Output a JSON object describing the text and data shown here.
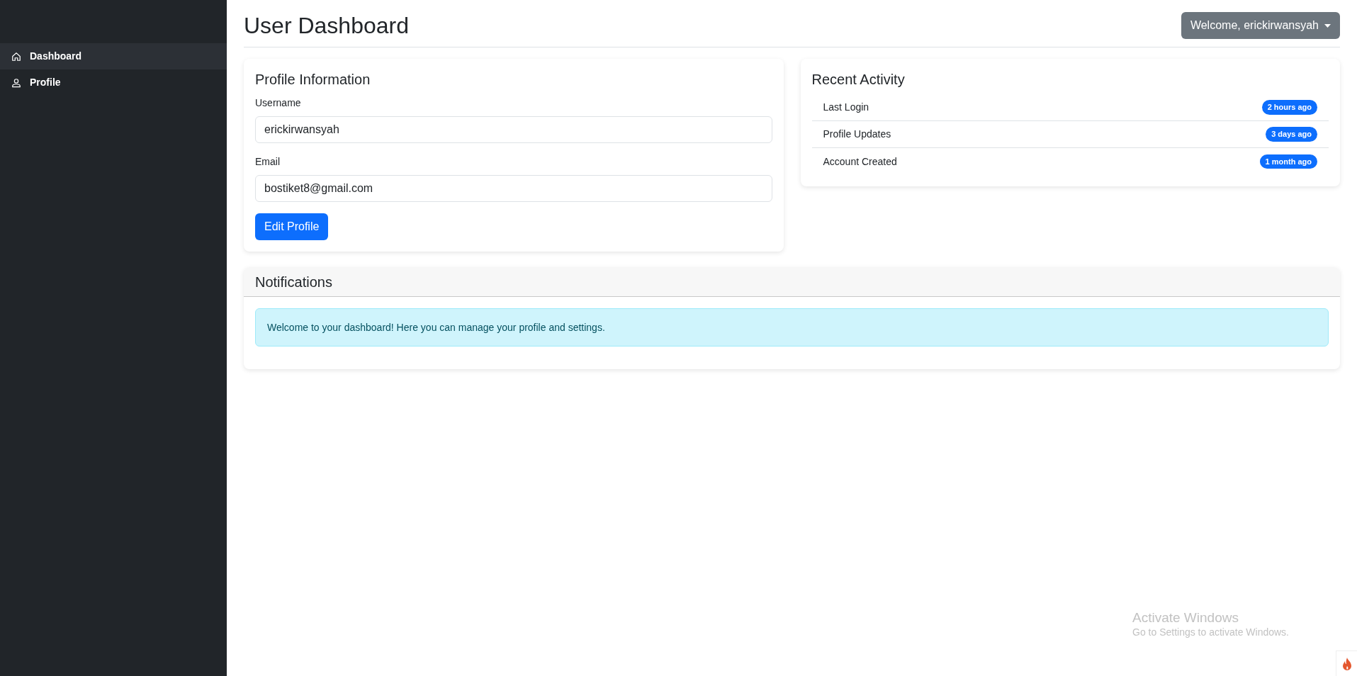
{
  "sidebar": {
    "items": [
      {
        "label": "Dashboard",
        "kind": "home",
        "selected": true
      },
      {
        "label": "Profile",
        "kind": "user",
        "selected": false
      }
    ]
  },
  "header": {
    "title": "User Dashboard",
    "user_menu": "Welcome, erickirwansyah"
  },
  "profile_card": {
    "title": "Profile Information",
    "fields": [
      {
        "label": "Username",
        "value": "erickirwansyah"
      },
      {
        "label": "Email",
        "value": "bostiket8@gmail.com"
      }
    ],
    "button": "Edit Profile"
  },
  "activity_card": {
    "title": "Recent Activity",
    "items": [
      {
        "label": "Last Login",
        "badge": "2 hours ago"
      },
      {
        "label": "Profile Updates",
        "badge": "3 days ago"
      },
      {
        "label": "Account Created",
        "badge": "1 month ago"
      }
    ]
  },
  "notifications_card": {
    "title": "Notifications",
    "alert": "Welcome to your dashboard! Here you can manage your profile and settings."
  },
  "os_overlay": {
    "title": "Activate Windows",
    "subtitle": "Go to Settings to activate Windows."
  }
}
